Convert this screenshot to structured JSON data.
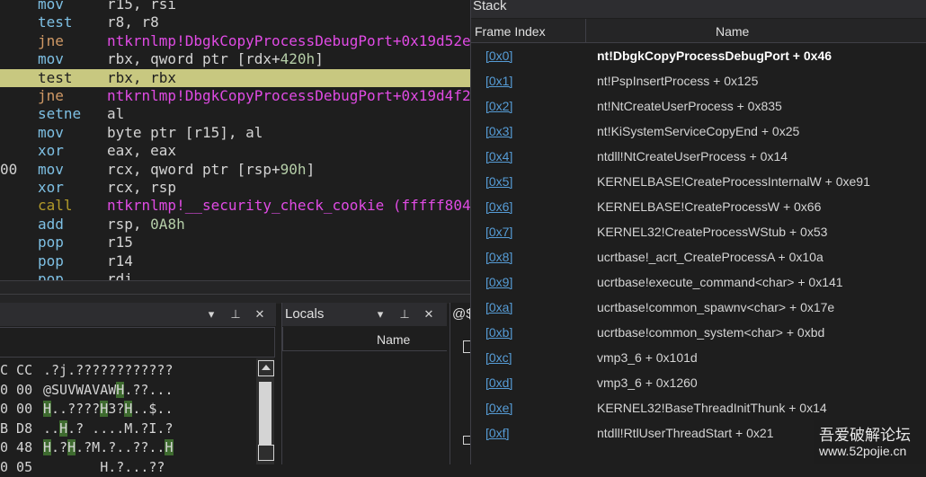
{
  "disassembly": [
    {
      "addr": "",
      "mn": "mov",
      "ops": [
        {
          "t": "r15, rsi"
        }
      ]
    },
    {
      "addr": "",
      "mn": "test",
      "ops": [
        {
          "t": "r8, r8"
        }
      ]
    },
    {
      "addr": "",
      "mn": "jne",
      "jump": true,
      "ops": [
        {
          "t": "ntkrnlmp!DbgkCopyProcessDebugPort+0x19d52e",
          "c": "sym"
        }
      ]
    },
    {
      "addr": "",
      "mn": "mov",
      "ops": [
        {
          "t": "rbx, qword ptr [rdx+"
        },
        {
          "t": "420h",
          "c": "num"
        },
        {
          "t": "]"
        }
      ]
    },
    {
      "addr": "",
      "mn": "test",
      "highlight": true,
      "ops": [
        {
          "t": "rbx, rbx"
        }
      ]
    },
    {
      "addr": "",
      "mn": "jne",
      "jump": true,
      "ops": [
        {
          "t": "ntkrnlmp!DbgkCopyProcessDebugPort+0x19d4f2",
          "c": "sym"
        }
      ]
    },
    {
      "addr": "",
      "mn": "setne",
      "ops": [
        {
          "t": "al"
        }
      ]
    },
    {
      "addr": "",
      "mn": "mov",
      "ops": [
        {
          "t": "byte ptr [r15], al"
        }
      ]
    },
    {
      "addr": "",
      "mn": "xor",
      "ops": [
        {
          "t": "eax, eax"
        }
      ]
    },
    {
      "addr": "00",
      "mn": "mov",
      "ops": [
        {
          "t": "rcx, qword ptr [rsp+"
        },
        {
          "t": "90h",
          "c": "num"
        },
        {
          "t": "]"
        }
      ]
    },
    {
      "addr": "",
      "mn": "xor",
      "ops": [
        {
          "t": "rcx, rsp"
        }
      ]
    },
    {
      "addr": "",
      "mn": "call",
      "call": true,
      "ops": [
        {
          "t": "ntkrnlmp!__security_check_cookie (fffff804",
          "c": "sym"
        }
      ]
    },
    {
      "addr": "",
      "mn": "add",
      "ops": [
        {
          "t": "rsp, "
        },
        {
          "t": "0A8h",
          "c": "num"
        }
      ]
    },
    {
      "addr": "",
      "mn": "pop",
      "ops": [
        {
          "t": "r15"
        }
      ]
    },
    {
      "addr": "",
      "mn": "pop",
      "ops": [
        {
          "t": "r14"
        }
      ]
    },
    {
      "addr": "",
      "mn": "pop",
      "ops": [
        {
          "t": "rdi"
        }
      ]
    }
  ],
  "memory": {
    "title_buttons": [
      "chevron-down-icon",
      "pin-icon",
      "close-icon"
    ],
    "rows": [
      {
        "hex": "C CC",
        "asc": [
          {
            "t": ".?j.????????????"
          }
        ]
      },
      {
        "hex": "0 00",
        "asc": [
          {
            "t": "@SUVWAVAW"
          },
          {
            "t": "H",
            "g": true
          },
          {
            "t": ".??..."
          }
        ]
      },
      {
        "hex": "0 00",
        "asc": [
          {
            "t": "H",
            "g": true
          },
          {
            "t": "..????"
          },
          {
            "t": "H",
            "g": true
          },
          {
            "t": "3?"
          },
          {
            "t": "H",
            "g": true
          },
          {
            "t": "..$.."
          }
        ]
      },
      {
        "hex": "B D8",
        "asc": [
          {
            "t": ".."
          },
          {
            "t": "H",
            "g": true
          },
          {
            "t": ".? ....M.?I.?"
          }
        ]
      },
      {
        "hex": "0 48",
        "asc": [
          {
            "t": "H",
            "g": true
          },
          {
            "t": ".?"
          },
          {
            "t": "H",
            "g": true
          },
          {
            "t": ".?M.?..??.."
          },
          {
            "t": "H",
            "g": true
          }
        ]
      },
      {
        "hex": "0 05",
        "asc": [
          {
            "t": "       H.?...??"
          }
        ]
      }
    ]
  },
  "locals": {
    "title": "Locals",
    "column_name": "Name"
  },
  "watch": {
    "title": "@$"
  },
  "stack": {
    "title": "Stack",
    "col_index": "Frame Index",
    "col_name": "Name",
    "frames": [
      {
        "idx": "[0x0]",
        "name": "nt!DbgkCopyProcessDebugPort + 0x46",
        "active": true
      },
      {
        "idx": "[0x1]",
        "name": "nt!PspInsertProcess + 0x125"
      },
      {
        "idx": "[0x2]",
        "name": "nt!NtCreateUserProcess + 0x835"
      },
      {
        "idx": "[0x3]",
        "name": "nt!KiSystemServiceCopyEnd + 0x25"
      },
      {
        "idx": "[0x4]",
        "name": "ntdll!NtCreateUserProcess + 0x14"
      },
      {
        "idx": "[0x5]",
        "name": "KERNELBASE!CreateProcessInternalW + 0xe91"
      },
      {
        "idx": "[0x6]",
        "name": "KERNELBASE!CreateProcessW + 0x66"
      },
      {
        "idx": "[0x7]",
        "name": "KERNEL32!CreateProcessWStub + 0x53"
      },
      {
        "idx": "[0x8]",
        "name": "ucrtbase!_acrt_CreateProcessA + 0x10a"
      },
      {
        "idx": "[0x9]",
        "name": "ucrtbase!execute_command<char> + 0x141"
      },
      {
        "idx": "[0xa]",
        "name": "ucrtbase!common_spawnv<char> + 0x17e"
      },
      {
        "idx": "[0xb]",
        "name": "ucrtbase!common_system<char> + 0xbd"
      },
      {
        "idx": "[0xc]",
        "name": "vmp3_6 + 0x101d"
      },
      {
        "idx": "[0xd]",
        "name": "vmp3_6 + 0x1260"
      },
      {
        "idx": "[0xe]",
        "name": "KERNEL32!BaseThreadInitThunk + 0x14"
      },
      {
        "idx": "[0xf]",
        "name": "ntdll!RtlUserThreadStart + 0x21"
      }
    ]
  },
  "watermark": {
    "line1": "吾爱破解论坛",
    "line2": "www.52pojie.cn"
  },
  "colors": {
    "highlight": "#c8c880",
    "symbol": "#e04be4",
    "link": "#569cd6",
    "number": "#b5cea8"
  }
}
